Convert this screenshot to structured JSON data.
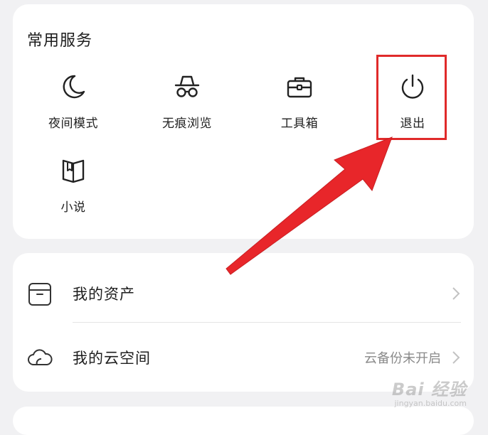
{
  "services": {
    "title": "常用服务",
    "items": [
      {
        "id": "night",
        "label": "夜间模式",
        "icon": "moon-icon"
      },
      {
        "id": "private",
        "label": "无痕浏览",
        "icon": "incognito-icon"
      },
      {
        "id": "tools",
        "label": "工具箱",
        "icon": "toolbox-icon"
      },
      {
        "id": "exit",
        "label": "退出",
        "icon": "power-icon"
      },
      {
        "id": "novel",
        "label": "小说",
        "icon": "book-icon"
      }
    ]
  },
  "account": {
    "assets_label": "我的资产",
    "cloud_label": "我的云空间",
    "cloud_status": "云备份未开启"
  },
  "annotation": {
    "highlight_color": "#e02a2a",
    "arrow_color": "#e8262a"
  },
  "watermark": {
    "main": "Bai 经验",
    "sub": "jingyan.baidu.com"
  }
}
